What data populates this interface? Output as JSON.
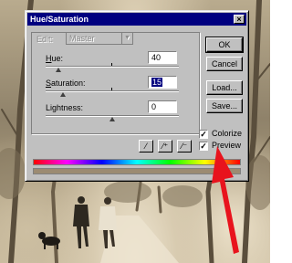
{
  "window": {
    "title": "Hue/Saturation",
    "close_glyph": "×"
  },
  "edit": {
    "label": "Edit:",
    "value": "Master"
  },
  "fields": {
    "hue": {
      "label_hotkey": "H",
      "label_rest": "ue:",
      "value": "40"
    },
    "saturation": {
      "label_hotkey": "S",
      "label_rest": "aturation:",
      "value": "15"
    },
    "lightness": {
      "label_hotkey": "",
      "label_rest": "Lightness:",
      "value": "0"
    }
  },
  "buttons": {
    "ok": "OK",
    "cancel": "Cancel",
    "load": "Load...",
    "save": "Save..."
  },
  "checkboxes": {
    "colorize": {
      "label": "Colorize",
      "checked": true
    },
    "preview": {
      "label": "Preview",
      "checked": true
    }
  },
  "icons": {
    "eyedropper": "eyedropper-icon",
    "eyedropper_plus": "eyedropper-plus-icon",
    "eyedropper_minus": "eyedropper-minus-icon"
  },
  "colors": {
    "titlebar": "#000080",
    "dialog_face": "#c0c0c0",
    "arrow": "#e8131d",
    "result_bar": "#9c8b72"
  }
}
